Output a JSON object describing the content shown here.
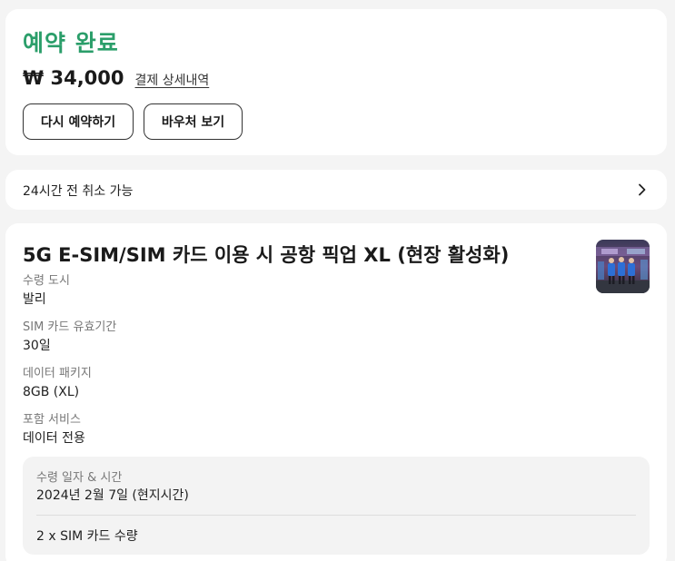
{
  "booking": {
    "status": "예약 완료",
    "price": "₩ 34,000",
    "payment_detail_link": "결제 상세내역",
    "rebook_label": "다시 예약하기",
    "voucher_label": "바우처 보기",
    "status_color": "#2b9e6a"
  },
  "cancellation": {
    "text": "24시간 전 취소 가능",
    "icon": "chevron-right-icon"
  },
  "product": {
    "title": "5G E-SIM/SIM 카드 이용 시 공항 픽업 XL (현장 활성화)",
    "details": [
      {
        "label": "수령 도시",
        "value": "발리"
      },
      {
        "label": "SIM 카드 유효기간",
        "value": "30일"
      },
      {
        "label": "데이터 패키지",
        "value": "8GB (XL)"
      },
      {
        "label": "포함 서비스",
        "value": "데이터 전용"
      }
    ],
    "schedule": {
      "label": "수령 일자 & 시간",
      "date": "2024년 2월 7일 (현지시간)",
      "quantity": "2 x SIM 카드 수량"
    }
  }
}
